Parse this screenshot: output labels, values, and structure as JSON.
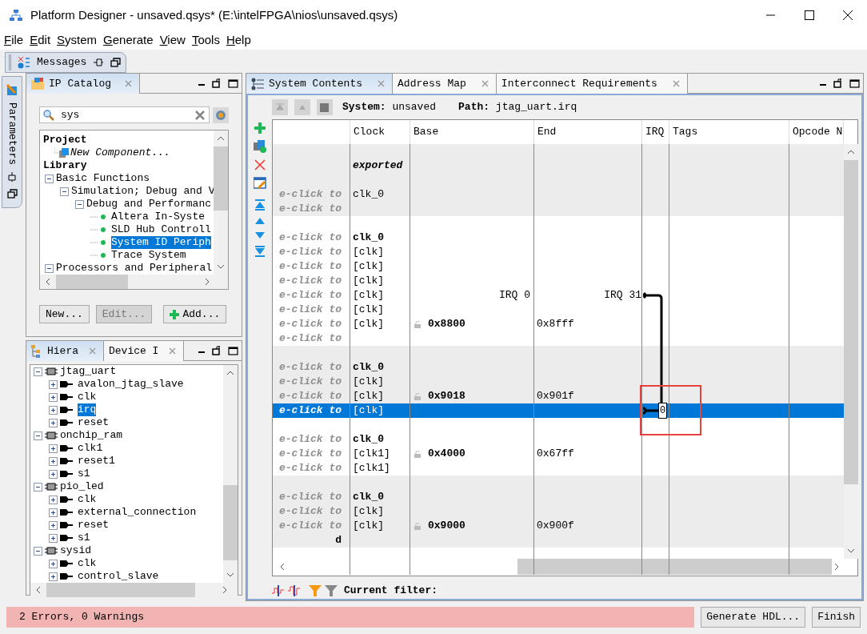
{
  "window": {
    "title": "Platform Designer - unsaved.qsys* (E:\\intelFPGA\\nios\\unsaved.qsys)"
  },
  "menu": [
    {
      "label": "File"
    },
    {
      "label": "Edit"
    },
    {
      "label": "System"
    },
    {
      "label": "Generate"
    },
    {
      "label": "View"
    },
    {
      "label": "Tools"
    },
    {
      "label": "Help"
    }
  ],
  "messages_tab": {
    "label": "Messages"
  },
  "parameters_tab": {
    "label": "Parameters"
  },
  "ip_catalog": {
    "title": "IP Catalog",
    "search": {
      "value": "sys"
    },
    "tree": [
      {
        "label": "Project",
        "kind": "heading",
        "children": [
          {
            "label": "New Component...",
            "kind": "component"
          }
        ]
      },
      {
        "label": "Library",
        "kind": "heading",
        "children": [
          {
            "label": "Basic Functions",
            "kind": "folder",
            "expanded": true,
            "children": [
              {
                "label": "Simulation; Debug and V",
                "kind": "folder",
                "expanded": true,
                "children": [
                  {
                    "label": "Debug and Performanc",
                    "kind": "folder",
                    "expanded": true,
                    "children": [
                      {
                        "label": "Altera In-Syste",
                        "kind": "ip",
                        "selected": false
                      },
                      {
                        "label": "SLD Hub Controll",
                        "kind": "ip",
                        "selected": false
                      },
                      {
                        "label": "System ID Periph",
                        "kind": "ip",
                        "selected": true
                      },
                      {
                        "label": "Trace System",
                        "kind": "ip",
                        "selected": false
                      }
                    ]
                  }
                ]
              }
            ]
          },
          {
            "label": "Processors and Peripheral",
            "kind": "folder",
            "expanded": true
          }
        ]
      }
    ],
    "buttons": [
      {
        "label": "New...",
        "kind": "plain",
        "disabled": false
      },
      {
        "label": "Edit...",
        "kind": "plain",
        "disabled": true
      },
      {
        "label": "Add...",
        "kind": "add",
        "disabled": false
      }
    ]
  },
  "hierarchy": {
    "tabs": [
      {
        "label": "Hiera",
        "selected": true
      },
      {
        "label": "Device I",
        "selected": false
      }
    ],
    "tree": [
      {
        "label": "jtag_uart",
        "expanded": true,
        "selected": false,
        "children": [
          {
            "label": "avalon_jtag_slave",
            "expanded": false,
            "selected": false
          },
          {
            "label": "clk",
            "expanded": false,
            "selected": false
          },
          {
            "label": "irq",
            "expanded": false,
            "selected": true
          },
          {
            "label": "reset",
            "expanded": false,
            "selected": false
          }
        ]
      },
      {
        "label": "onchip_ram",
        "expanded": true,
        "selected": false,
        "children": [
          {
            "label": "clk1",
            "expanded": false,
            "selected": false
          },
          {
            "label": "reset1",
            "expanded": false,
            "selected": false
          },
          {
            "label": "s1",
            "expanded": false,
            "selected": false
          }
        ]
      },
      {
        "label": "pio_led",
        "expanded": true,
        "selected": false,
        "children": [
          {
            "label": "clk",
            "expanded": false,
            "selected": false
          },
          {
            "label": "external_connection",
            "expanded": false,
            "selected": false
          },
          {
            "label": "reset",
            "expanded": false,
            "selected": false
          },
          {
            "label": "s1",
            "expanded": false,
            "selected": false
          }
        ]
      },
      {
        "label": "sysid",
        "expanded": true,
        "selected": false,
        "children": [
          {
            "label": "clk",
            "expanded": false,
            "selected": false
          },
          {
            "label": "control_slave",
            "expanded": false,
            "selected": false
          }
        ]
      }
    ]
  },
  "main": {
    "tabs": [
      {
        "label": "System Contents",
        "selected": true
      },
      {
        "label": "Address Map",
        "selected": false
      },
      {
        "label": "Interconnect Requirements",
        "selected": false
      }
    ],
    "system": "**System:** unsaved",
    "path": "**Path:** jtag_uart.irq",
    "columns": [
      "Clock",
      "Base",
      "End",
      "IRQ",
      "Tags",
      "Opcode N"
    ],
    "groups": [
      {
        "rows": [
          {
            "selected": false
          },
          {
            "clock": "exported",
            "clock_bold": true,
            "clock_italic": true,
            "selected": false
          },
          {
            "selected": false
          },
          {
            "name": "e-click to",
            "clock": "clk_0",
            "selected": false
          },
          {
            "name": "e-click to",
            "selected": false
          }
        ]
      },
      {
        "rows": [
          {
            "selected": false
          },
          {
            "name": "e-click to",
            "clock": "clk_0",
            "clock_bold": true,
            "selected": false
          },
          {
            "name": "e-click to",
            "clock": "[clk]",
            "selected": false
          },
          {
            "name": "e-click to",
            "clock": "[clk]",
            "selected": false
          },
          {
            "name": "e-click to",
            "clock": "[clk]",
            "selected": false
          },
          {
            "name": "e-click to",
            "clock": "[clk]",
            "base_note": "IRQ 0",
            "end_note": "IRQ 31",
            "selected": false
          },
          {
            "name": "e-click to",
            "clock": "[clk]",
            "selected": false
          },
          {
            "name": "e-click to",
            "clock": "[clk]",
            "base": "0x8800",
            "end": "0x8fff",
            "selected": false
          },
          {
            "name": "e-click to",
            "selected": false
          }
        ]
      },
      {
        "rows": [
          {
            "selected": false
          },
          {
            "name": "e-click to",
            "clock": "clk_0",
            "clock_bold": true,
            "selected": false
          },
          {
            "name": "e-click to",
            "clock": "[clk]",
            "selected": false
          },
          {
            "name": "e-click to",
            "clock": "[clk]",
            "base": "0x9018",
            "end": "0x901f",
            "selected": false
          },
          {
            "name": "e-click to",
            "clock": "[clk]",
            "selected": true
          }
        ]
      },
      {
        "rows": [
          {
            "selected": false
          },
          {
            "name": "e-click to",
            "clock": "clk_0",
            "clock_bold": true,
            "selected": false
          },
          {
            "name": "e-click to",
            "clock": "[clk1]",
            "base": "0x4000",
            "end": "0x67ff",
            "selected": false
          },
          {
            "name": "e-click to",
            "clock": "[clk1]",
            "selected": false
          }
        ]
      },
      {
        "rows": [
          {
            "selected": false
          },
          {
            "name": "e-click to",
            "clock": "clk_0",
            "clock_bold": true,
            "selected": false
          },
          {
            "name": "e-click to",
            "clock": "[clk]",
            "selected": false
          },
          {
            "name": "e-click to",
            "clock": "[clk]",
            "base": "0x9000",
            "end": "0x900f",
            "selected": false
          },
          {
            "name": "d",
            "name_bold": true,
            "selected": false
          }
        ]
      }
    ],
    "irq_number": "0",
    "filter": {
      "label": "Current filter:"
    }
  },
  "status": {
    "message": "2 Errors, 0 Warnings",
    "error": true
  },
  "actions": [
    {
      "label": "Generate HDL..."
    },
    {
      "label": "Finish"
    }
  ]
}
